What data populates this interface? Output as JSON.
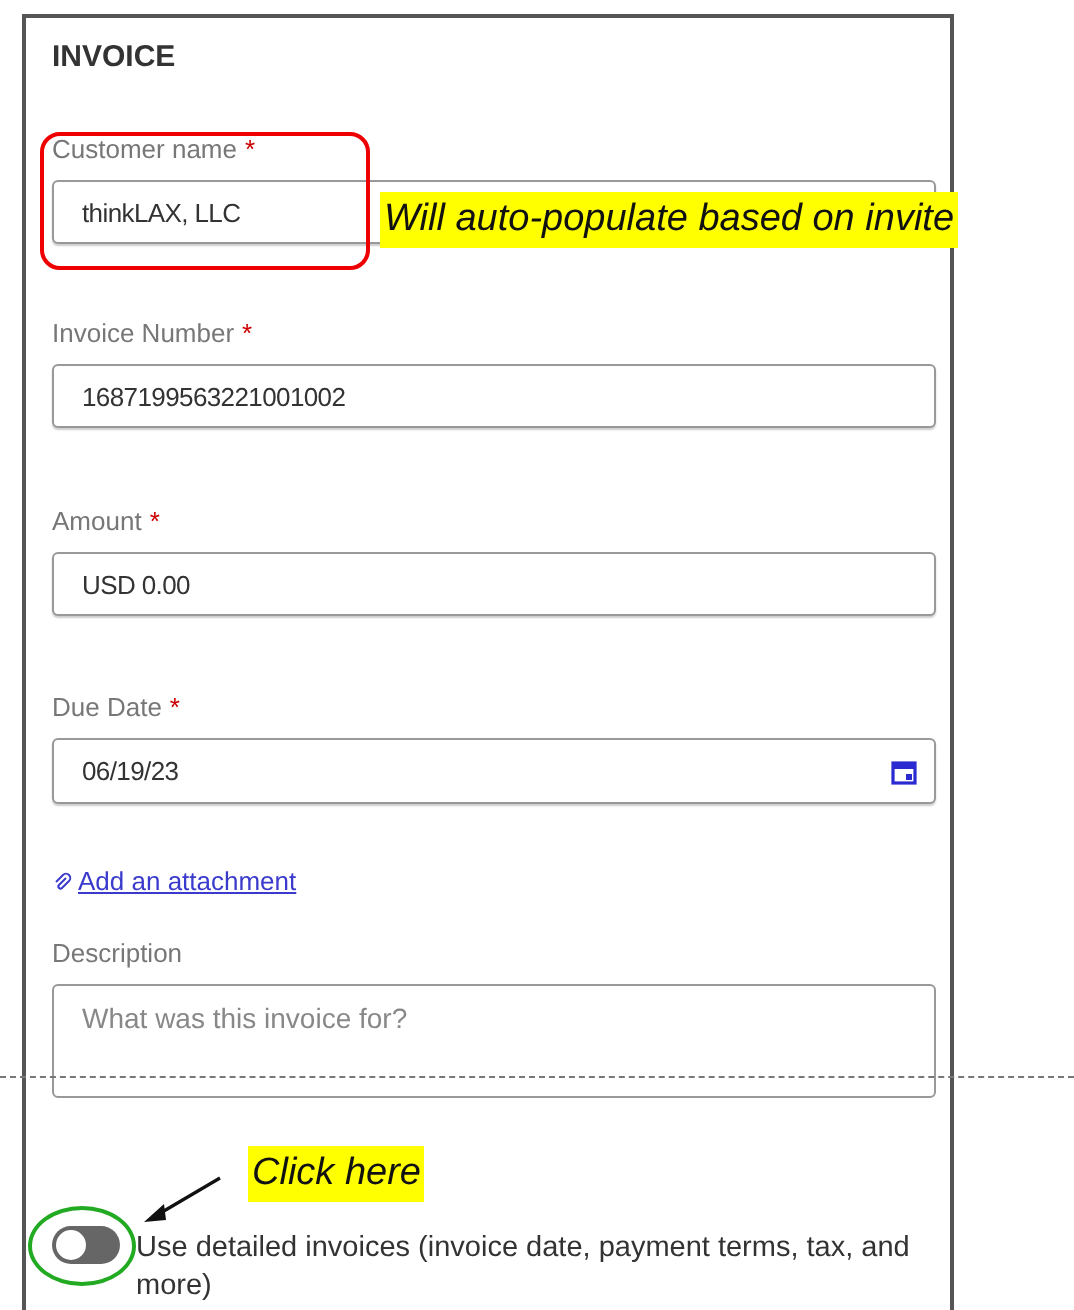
{
  "panel": {
    "title": "INVOICE"
  },
  "fields": [
    {
      "kind": "text",
      "label": "Customer name",
      "required_mark": "*",
      "value": "thinkLAX, LLC"
    },
    {
      "kind": "text",
      "label": "Invoice Number",
      "required_mark": "*",
      "value": "1687199563221001002"
    },
    {
      "kind": "text",
      "label": "Amount",
      "required_mark": "*",
      "value": "USD 0.00"
    },
    {
      "kind": "date",
      "label": "Due Date",
      "required_mark": "*",
      "value": "06/19/23"
    }
  ],
  "attachment_link": "Add an attachment",
  "description": {
    "kind": "textarea",
    "label": "Description",
    "placeholder": "What was this invoice for?"
  },
  "detailed_toggle": {
    "on": false,
    "label": "Use detailed invoices (invoice date, payment terms, tax, and more)"
  },
  "annotations": [
    {
      "kind": "field-note",
      "text": "Will auto-populate based on invite"
    },
    {
      "kind": "toggle-note",
      "text": "Click here"
    }
  ]
}
